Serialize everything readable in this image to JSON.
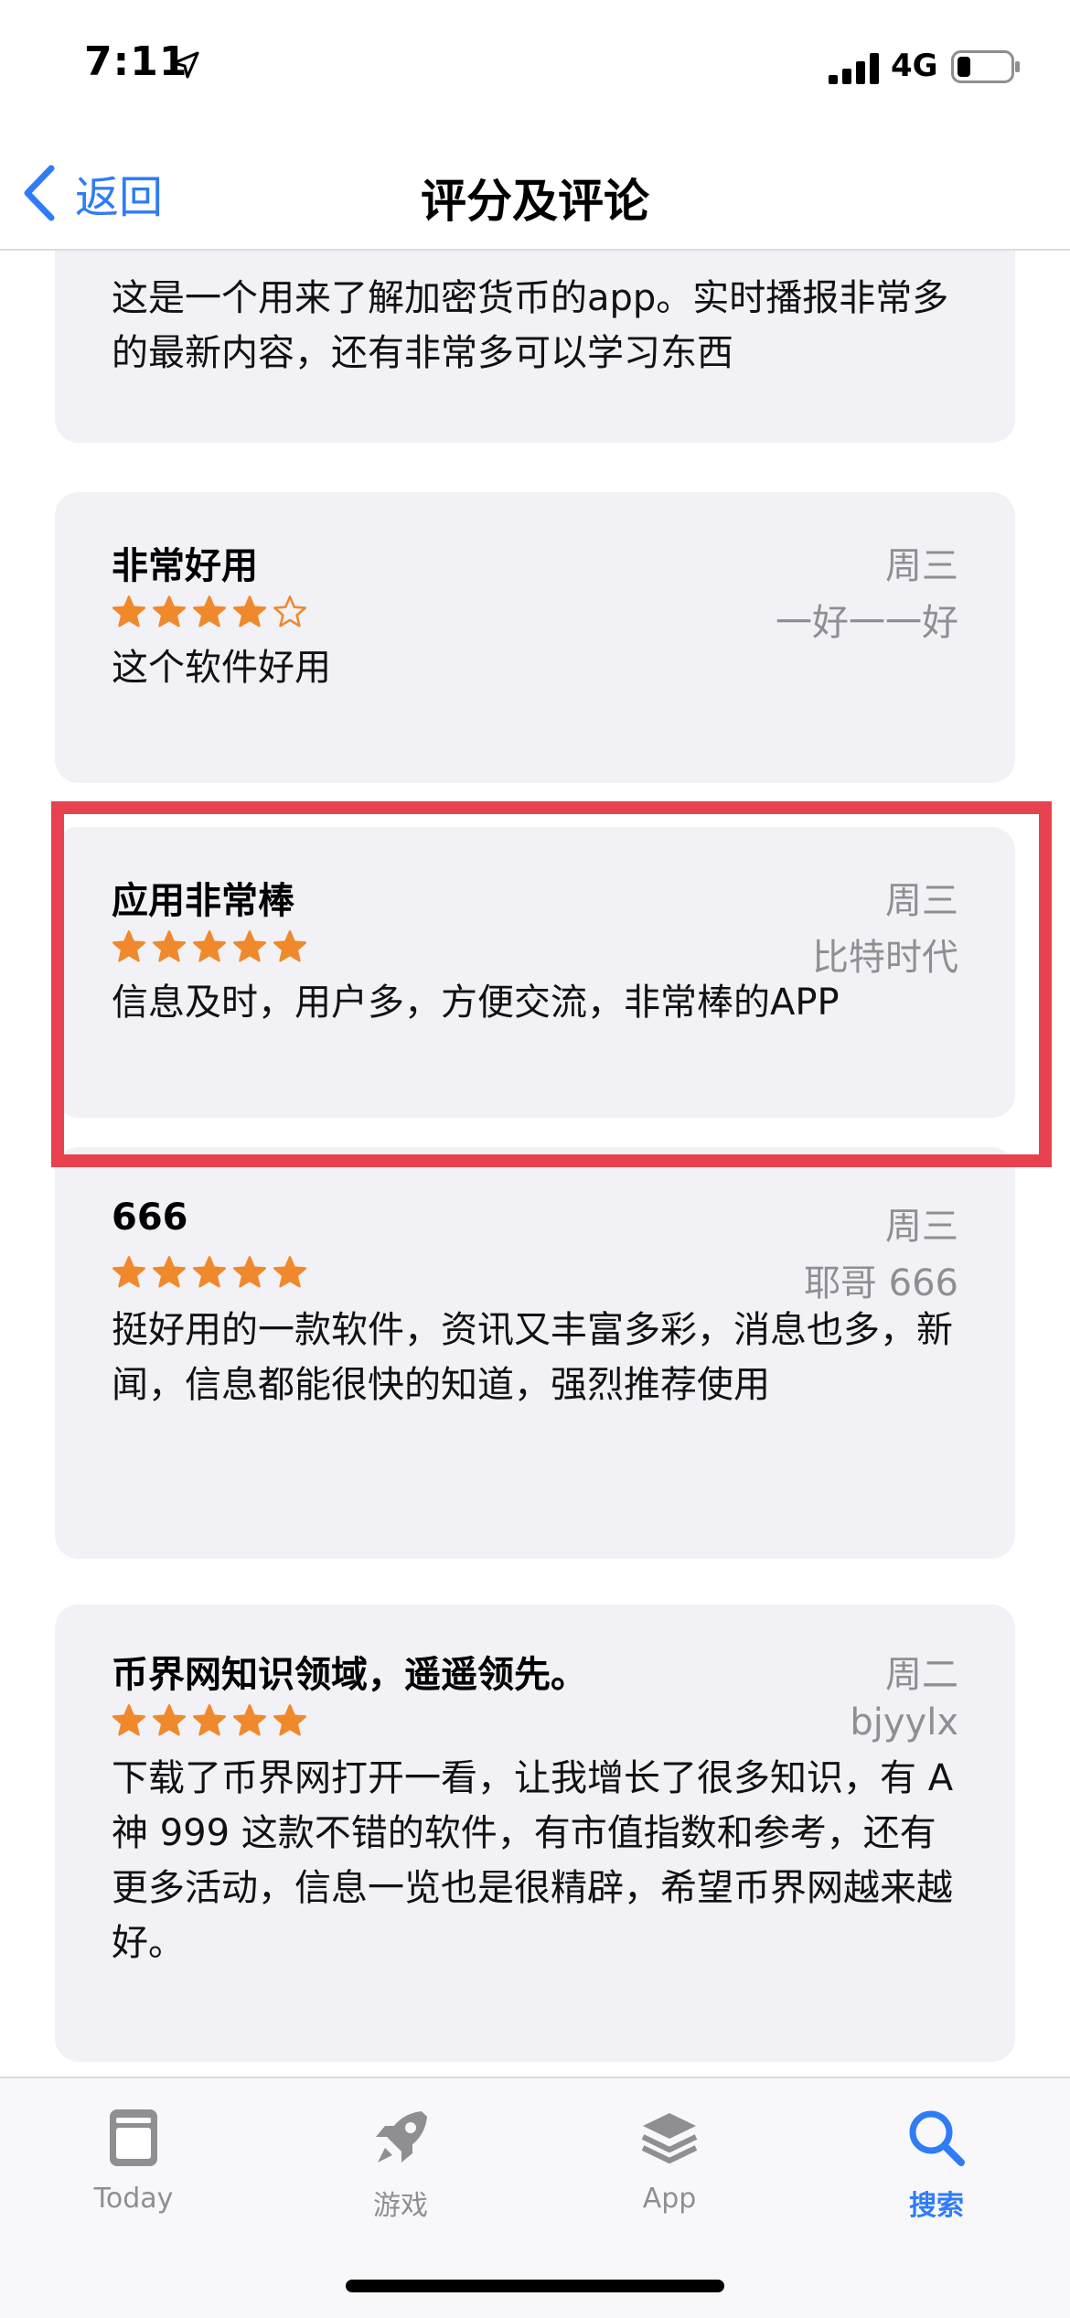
{
  "status_bar": {
    "time": "7:11",
    "network": "4G"
  },
  "nav": {
    "back_label": "返回",
    "title": "评分及评论"
  },
  "reviews": [
    {
      "title": "",
      "stars": 0,
      "date": "",
      "author": "",
      "body": "这是一个用来了解加密货币的app。实时播报非常多的最新内容，还有非常多可以学习东西"
    },
    {
      "title": "非常好用",
      "stars": 4,
      "date": "周三",
      "author": "一好一一好",
      "body": "这个软件好用"
    },
    {
      "title": "应用非常棒",
      "stars": 5,
      "date": "周三",
      "author": "比特时代",
      "body": "信息及时，用户多，方便交流，非常棒的APP"
    },
    {
      "title": "666",
      "stars": 5,
      "date": "周三",
      "author": "耶哥 666",
      "body": "挺好用的一款软件，资讯又丰富多彩，消息也多，新闻，信息都能很快的知道，强烈推荐使用"
    },
    {
      "title": "币界网知识领域，遥遥领先。",
      "stars": 5,
      "date": "周二",
      "author": "bjyylx",
      "body": "下载了币界网打开一看，让我增长了很多知识，有 A 神 999 这款不错的软件，有市值指数和参考，还有更多活动，信息一览也是很精辟，希望币界网越来越好。"
    }
  ],
  "tabs": [
    {
      "label": "Today",
      "icon": "today-icon",
      "active": false
    },
    {
      "label": "游戏",
      "icon": "rocket-icon",
      "active": false
    },
    {
      "label": "App",
      "icon": "app-stack-icon",
      "active": false
    },
    {
      "label": "搜索",
      "icon": "search-icon",
      "active": true
    }
  ],
  "colors": {
    "accent": "#2f7cf6",
    "star": "#f0892b",
    "highlight": "#e8414f",
    "card_bg": "#f1f1f6"
  }
}
